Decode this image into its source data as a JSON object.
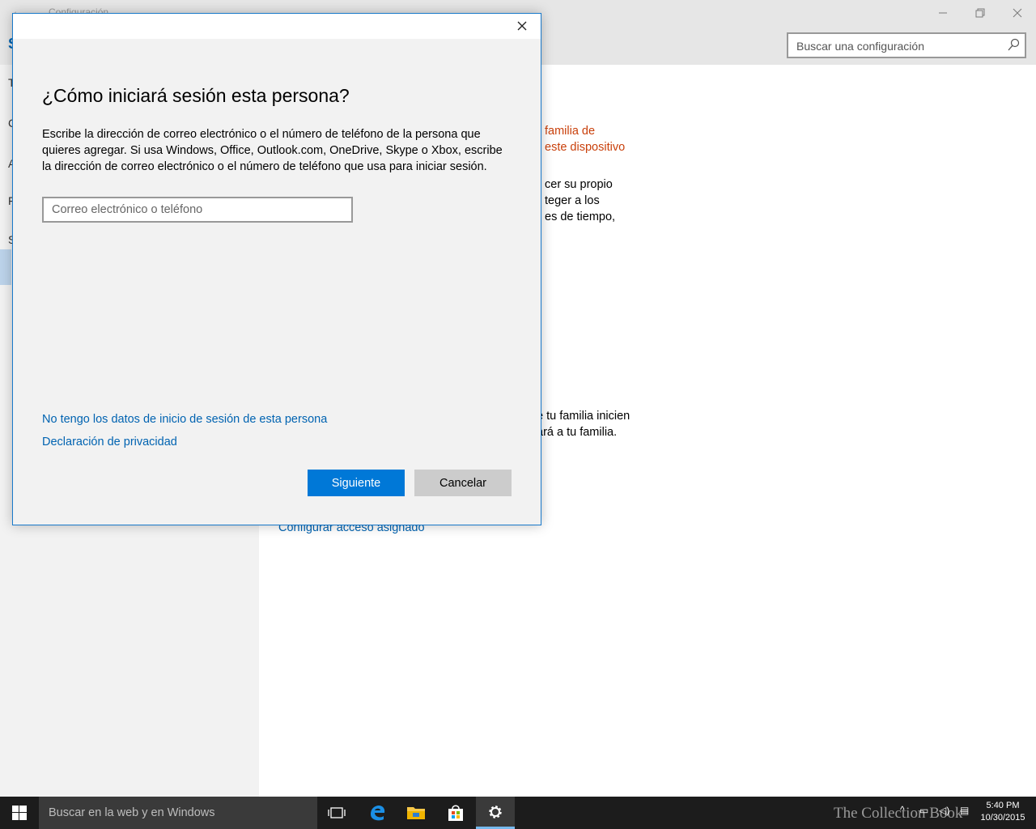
{
  "window": {
    "title": "Configuración",
    "search_placeholder": "Buscar una configuración"
  },
  "sidebar": {
    "app_letter": "S",
    "items": [
      "T",
      "C",
      "A",
      "F",
      "S"
    ]
  },
  "content": {
    "orange_line1": "familia de",
    "orange_line2": "este dispositivo",
    "para1_line1": "cer su propio",
    "para1_line2": "teger a los",
    "para1_line3": "es de tiempo,",
    "para2_line1": "e tu familia inicien",
    "para2_line2": "ará a tu familia.",
    "assigned_access_link": "Configurar acceso asignado"
  },
  "dialog": {
    "title": "¿Cómo iniciará sesión esta persona?",
    "description": "Escribe la dirección de correo electrónico o el número de teléfono de la persona que quieres agregar. Si usa Windows, Office, Outlook.com, OneDrive, Skype o Xbox, escribe la dirección de correo electrónico o el número de teléfono que usa para iniciar sesión.",
    "input_placeholder": "Correo electrónico o teléfono",
    "no_data_link": "No tengo los datos de inicio de sesión de esta persona",
    "privacy_link": "Declaración de privacidad",
    "next_button": "Siguiente",
    "cancel_button": "Cancelar"
  },
  "taskbar": {
    "search_placeholder": "Buscar en la web y en Windows",
    "time": "5:40 PM",
    "date": "10/30/2015",
    "watermark": "The Collection Book"
  },
  "colors": {
    "accent": "#0078d7",
    "link": "#0063b1",
    "orange": "#c9400b",
    "taskbar": "#1c1c1c"
  }
}
